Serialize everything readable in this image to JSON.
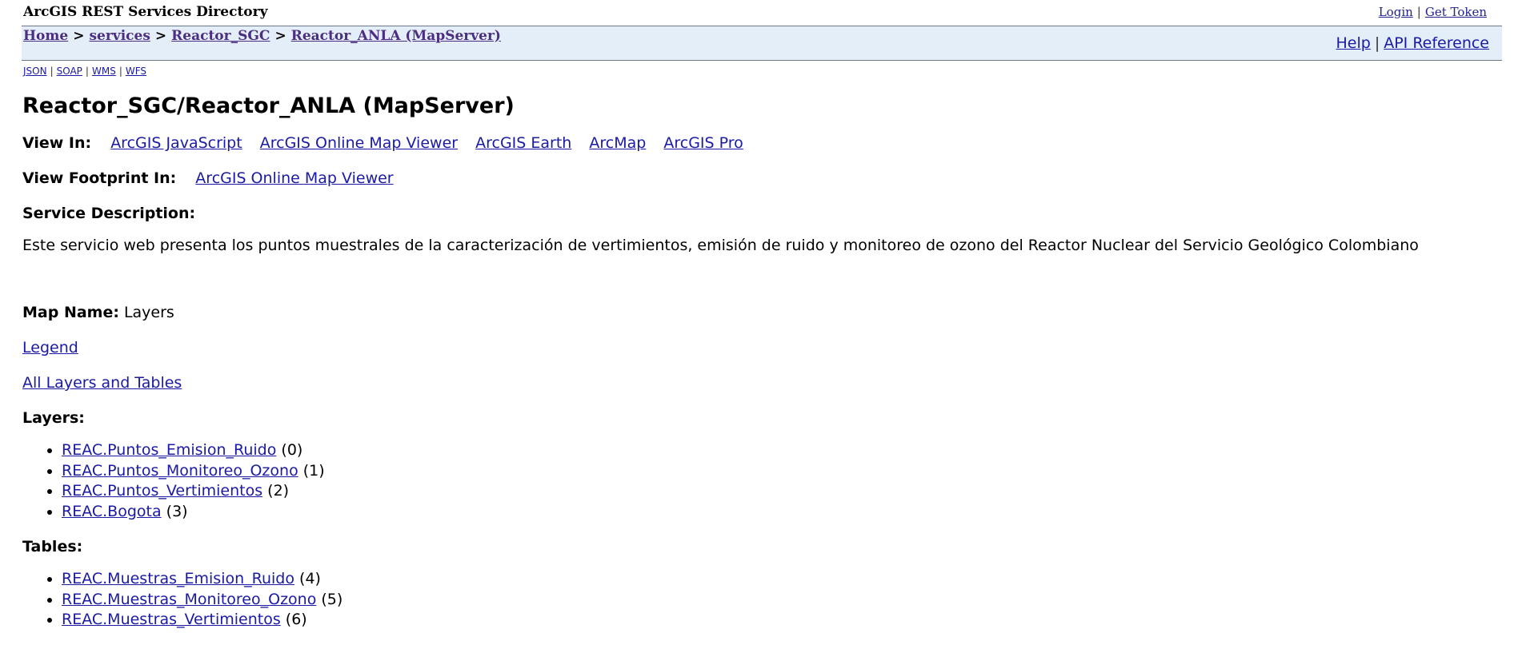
{
  "header": {
    "app_title": "ArcGIS REST Services Directory",
    "login": "Login",
    "get_token": "Get Token",
    "separator": "|"
  },
  "breadcrumb": {
    "items": [
      "Home",
      "services",
      "Reactor_SGC",
      "Reactor_ANLA (MapServer)"
    ],
    "divider": ">"
  },
  "help": {
    "help_label": "Help",
    "api_reference": "API Reference"
  },
  "formats": [
    "JSON",
    "SOAP",
    "WMS",
    "WFS"
  ],
  "page_title": "Reactor_SGC/Reactor_ANLA (MapServer)",
  "view_in": {
    "label": "View In:",
    "links": [
      "ArcGIS JavaScript",
      "ArcGIS Online Map Viewer",
      "ArcGIS Earth",
      "ArcMap",
      "ArcGIS Pro"
    ]
  },
  "view_footprint": {
    "label": "View Footprint In:",
    "link": "ArcGIS Online Map Viewer"
  },
  "service_description": {
    "label": "Service Description:",
    "text": "Este servicio web presenta los puntos muestrales de la caracterización de vertimientos, emisión de ruido y monitoreo de ozono del Reactor Nuclear del Servicio Geológico Colombiano"
  },
  "map_name": {
    "label": "Map Name:",
    "value": "Layers"
  },
  "legend_link": "Legend",
  "all_layers_link": "All Layers and Tables",
  "layers": {
    "label": "Layers:",
    "items": [
      {
        "name": "REAC.Puntos_Emision_Ruido",
        "id": "(0)"
      },
      {
        "name": "REAC.Puntos_Monitoreo_Ozono",
        "id": "(1)"
      },
      {
        "name": "REAC.Puntos_Vertimientos",
        "id": "(2)"
      },
      {
        "name": "REAC.Bogota",
        "id": "(3)"
      }
    ]
  },
  "tables": {
    "label": "Tables:",
    "items": [
      {
        "name": "REAC.Muestras_Emision_Ruido",
        "id": "(4)"
      },
      {
        "name": "REAC.Muestras_Monitoreo_Ozono",
        "id": "(5)"
      },
      {
        "name": "REAC.Muestras_Vertimientos",
        "id": "(6)"
      }
    ]
  }
}
